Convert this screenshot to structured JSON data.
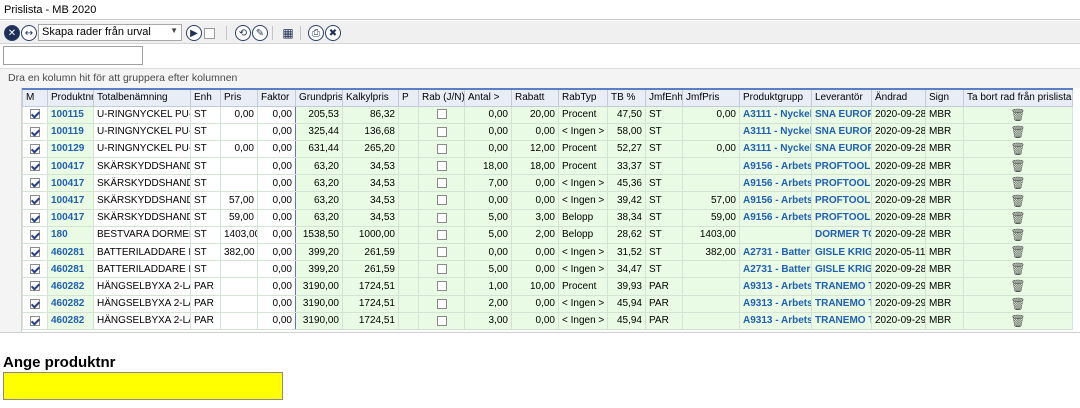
{
  "window": {
    "title": "Prislista - MB 2020"
  },
  "toolbar": {
    "combo_value": "Skapa rader från urval",
    "icons": [
      "close-icon",
      "columns-icon",
      "play-icon",
      "refresh-icon",
      "pin-icon",
      "calculator-icon",
      "print-icon",
      "delete-icon"
    ]
  },
  "filter": {
    "value": ""
  },
  "groupbar": {
    "text": "Dra en kolumn hit för att gruppera efter kolumnen"
  },
  "columns": [
    "M",
    "Produktnr",
    "Totalbenämning",
    "Enh",
    "Pris",
    "Faktor",
    "Grundpris",
    "Kalkylpris",
    "P",
    "Rab (J/N)",
    "Antal >",
    "Rabatt",
    "RabTyp",
    "TB %",
    "JmfEnh",
    "JmfPris",
    "Produktgrupp",
    "Leverantör",
    "Ändrad",
    "Sign",
    "Ta bort rad från prislistan"
  ],
  "rows": [
    {
      "checked": true,
      "produktnr": "100115",
      "benamning": "U-RINGNYCKEL PU-17M",
      "enh": "ST",
      "pris": "0,00",
      "faktor": "0,00",
      "grundpris": "205,53",
      "kalkylpris": "86,32",
      "p": "",
      "rab": false,
      "antal": "0,00",
      "rabatt": "20,00",
      "rabtyp": "Procent",
      "tb": "47,50",
      "jmfenh": "ST",
      "jmfpris": "0,00",
      "grupp": "A3111 - Nyckelve",
      "lev": "SNA EUROPE",
      "andrad": "2020-09-28",
      "sign": "MBR"
    },
    {
      "checked": true,
      "produktnr": "100119",
      "benamning": "U-RINGNYCKEL PU-21M",
      "enh": "ST",
      "pris": "",
      "faktor": "0,00",
      "grundpris": "325,44",
      "kalkylpris": "136,68",
      "p": "",
      "rab": false,
      "antal": "0,00",
      "rabatt": "0,00",
      "rabtyp": "< Ingen >",
      "tb": "58,00",
      "jmfenh": "ST",
      "jmfpris": "",
      "grupp": "A3111 - Nyckelve",
      "lev": "SNA EUROPE",
      "andrad": "2020-09-28",
      "sign": "MBR"
    },
    {
      "checked": true,
      "produktnr": "100129",
      "benamning": "U-RINGNYCKEL PU-32M",
      "enh": "ST",
      "pris": "0,00",
      "faktor": "0,00",
      "grundpris": "631,44",
      "kalkylpris": "265,20",
      "p": "",
      "rab": false,
      "antal": "0,00",
      "rabatt": "12,00",
      "rabtyp": "Procent",
      "tb": "52,27",
      "jmfenh": "ST",
      "jmfpris": "0,00",
      "grupp": "A3111 - Nyckelve",
      "lev": "SNA EUROPE",
      "andrad": "2020-09-28",
      "sign": "MBR"
    },
    {
      "checked": true,
      "produktnr": "100417",
      "benamning": "SKÄRSKYDDSHANDSKE",
      "enh": "ST",
      "pris": "",
      "faktor": "0,00",
      "grundpris": "63,20",
      "kalkylpris": "34,53",
      "p": "",
      "rab": false,
      "antal": "18,00",
      "rabatt": "18,00",
      "rabtyp": "Procent",
      "tb": "33,37",
      "jmfenh": "ST",
      "jmfpris": "",
      "grupp": "A9156 - Arbets- M",
      "lev": "PROFTOOL EU",
      "andrad": "2020-09-28",
      "sign": "MBR"
    },
    {
      "checked": true,
      "produktnr": "100417",
      "benamning": "SKÄRSKYDDSHANDSKE",
      "enh": "ST",
      "pris": "",
      "faktor": "0,00",
      "grundpris": "63,20",
      "kalkylpris": "34,53",
      "p": "",
      "rab": false,
      "antal": "7,00",
      "rabatt": "0,00",
      "rabtyp": "< Ingen >",
      "tb": "45,36",
      "jmfenh": "ST",
      "jmfpris": "",
      "grupp": "A9156 - Arbets- M",
      "lev": "PROFTOOL EU",
      "andrad": "2020-09-29",
      "sign": "MBR"
    },
    {
      "checked": true,
      "produktnr": "100417",
      "benamning": "SKÄRSKYDDSHANDSKE",
      "enh": "ST",
      "pris": "57,00",
      "faktor": "0,00",
      "grundpris": "63,20",
      "kalkylpris": "34,53",
      "p": "",
      "rab": false,
      "antal": "0,00",
      "rabatt": "0,00",
      "rabtyp": "< Ingen >",
      "tb": "39,42",
      "jmfenh": "ST",
      "jmfpris": "57,00",
      "grupp": "A9156 - Arbets- M",
      "lev": "PROFTOOL EU",
      "andrad": "2020-09-28",
      "sign": "MBR"
    },
    {
      "checked": true,
      "produktnr": "100417",
      "benamning": "SKÄRSKYDDSHANDSKE",
      "enh": "ST",
      "pris": "59,00",
      "faktor": "0,00",
      "grundpris": "63,20",
      "kalkylpris": "34,53",
      "p": "",
      "rab": false,
      "antal": "5,00",
      "rabatt": "3,00",
      "rabtyp": "Belopp",
      "tb": "38,34",
      "jmfenh": "ST",
      "jmfpris": "59,00",
      "grupp": "A9156 - Arbets- M",
      "lev": "PROFTOOL EU",
      "andrad": "2020-09-28",
      "sign": "MBR"
    },
    {
      "checked": true,
      "produktnr": "180",
      "benamning": "BESTVARA DORMER TOO",
      "enh": "ST",
      "pris": "1403,00",
      "faktor": "0,00",
      "grundpris": "1538,50",
      "kalkylpris": "1000,00",
      "p": "",
      "rab": false,
      "antal": "5,00",
      "rabatt": "2,00",
      "rabtyp": "Belopp",
      "tb": "28,62",
      "jmfenh": "ST",
      "jmfpris": "1403,00",
      "grupp": "",
      "lev": "DORMER TOO",
      "andrad": "2020-09-28",
      "sign": "MBR"
    },
    {
      "checked": true,
      "produktnr": "460281",
      "benamning": "BATTERILADDARE ELEKT",
      "enh": "ST",
      "pris": "382,00",
      "faktor": "0,00",
      "grundpris": "399,20",
      "kalkylpris": "261,59",
      "p": "",
      "rab": false,
      "antal": "0,00",
      "rabatt": "0,00",
      "rabtyp": "< Ingen >",
      "tb": "31,52",
      "jmfenh": "ST",
      "jmfpris": "382,00",
      "grupp": "A2731 - Batteriladd",
      "lev": "GISLE KRIGSV",
      "andrad": "2020-05-11",
      "sign": "MBR"
    },
    {
      "checked": true,
      "produktnr": "460281",
      "benamning": "BATTERILADDARE ELEKT",
      "enh": "ST",
      "pris": "",
      "faktor": "0,00",
      "grundpris": "399,20",
      "kalkylpris": "261,59",
      "p": "",
      "rab": false,
      "antal": "5,00",
      "rabatt": "0,00",
      "rabtyp": "< Ingen >",
      "tb": "34,47",
      "jmfenh": "ST",
      "jmfpris": "",
      "grupp": "A2731 - Batteriladd",
      "lev": "GISLE KRIGSV",
      "andrad": "2020-09-28",
      "sign": "MBR"
    },
    {
      "checked": true,
      "produktnr": "460282",
      "benamning": "HÄNGSELBYXA 2-LAGER",
      "enh": "PAR",
      "pris": "",
      "faktor": "0,00",
      "grundpris": "3190,00",
      "kalkylpris": "1724,51",
      "p": "",
      "rab": false,
      "antal": "1,00",
      "rabatt": "10,00",
      "rabtyp": "Procent",
      "tb": "39,93",
      "jmfenh": "PAR",
      "jmfpris": "",
      "grupp": "A9313 - Arbetskla",
      "lev": "TRANEMO TE",
      "andrad": "2020-09-29",
      "sign": "MBR"
    },
    {
      "checked": true,
      "produktnr": "460282",
      "benamning": "HÄNGSELBYXA 2-LAGER",
      "enh": "PAR",
      "pris": "",
      "faktor": "0,00",
      "grundpris": "3190,00",
      "kalkylpris": "1724,51",
      "p": "",
      "rab": false,
      "antal": "2,00",
      "rabatt": "0,00",
      "rabtyp": "< Ingen >",
      "tb": "45,94",
      "jmfenh": "PAR",
      "jmfpris": "",
      "grupp": "A9313 - Arbetskla",
      "lev": "TRANEMO TE",
      "andrad": "2020-09-29",
      "sign": "MBR"
    },
    {
      "checked": true,
      "produktnr": "460282",
      "benamning": "HÄNGSELBYXA 2-LAGER",
      "enh": "PAR",
      "pris": "",
      "faktor": "0,00",
      "grundpris": "3190,00",
      "kalkylpris": "1724,51",
      "p": "",
      "rab": false,
      "antal": "3,00",
      "rabatt": "0,00",
      "rabtyp": "< Ingen >",
      "tb": "45,94",
      "jmfenh": "PAR",
      "jmfpris": "",
      "grupp": "A9313 - Arbetskla",
      "lev": "TRANEMO TE",
      "andrad": "2020-09-29",
      "sign": "MBR"
    }
  ],
  "prompt": {
    "label": "Ange produktnr",
    "value": ""
  },
  "colors": {
    "row_bg": "#e9fbe4",
    "link": "#1f5fb5",
    "prompt_field": "#ffff00"
  }
}
